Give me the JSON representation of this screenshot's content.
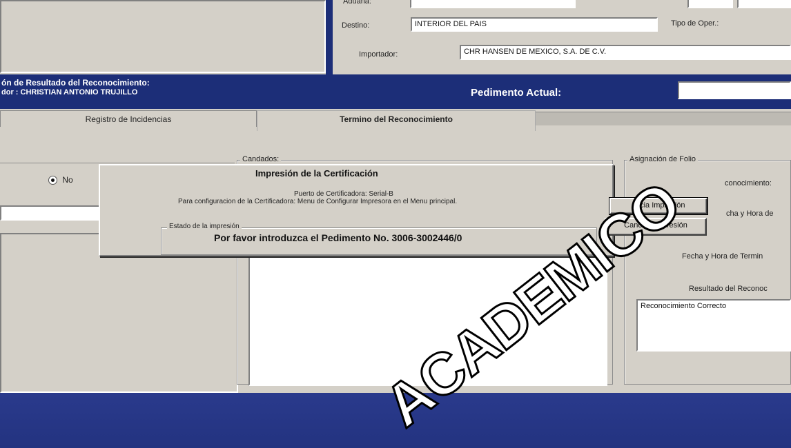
{
  "header": {
    "aduana_label": "Aduana:",
    "destino_label": "Destino:",
    "destino_value": "INTERIOR DEL PAIS",
    "tipo_oper_label": "Tipo de Oper.:",
    "importador_label": "Importador:",
    "importador_value": "CHR HANSEN DE MEXICO, S.A. DE C.V."
  },
  "status_bar": {
    "line1": "ón de Resultado del Reconocimiento:",
    "line2": "dor : CHRISTIAN ANTONIO TRUJILLO",
    "pedimento_label": "Pedimento Actual:",
    "pedimento_value": ""
  },
  "tabs": [
    {
      "label": "Registro de Incidencias"
    },
    {
      "label": "Termino del Reconocimiento"
    }
  ],
  "left_panel": {
    "radio_no_label": "No"
  },
  "candados": {
    "label": "Candados:"
  },
  "folio": {
    "group_label": "Asignación de Folio",
    "reconocimiento_label": "conocimiento:",
    "fecha_hora_label": "cha y Hora de",
    "fecha_termino_label": "Fecha y Hora de Termin",
    "resultado_label": "Resultado del Reconoc",
    "resultado_value": "Reconocimiento Correcto"
  },
  "dialog": {
    "title": "Impresión de la Certificación",
    "puerto_text": "Puerto de Certificadora: Serial-B",
    "config_text": "Para configuracion de la Certificadora: Menu de Configurar Impresora en el Menu principal.",
    "estado_label": "Estado de la impresión",
    "message": "Por favor introduzca el Pedimento No. 3006-3002446/0",
    "start_button": "Inicia Impresión",
    "cancel_button": "Cancela Impresión"
  },
  "watermark": {
    "text": "ACADEMICO"
  },
  "colors": {
    "window_bg": "#d4d0c8",
    "status_bar": "#1c2e78",
    "desktop": "#2a3a8c"
  }
}
